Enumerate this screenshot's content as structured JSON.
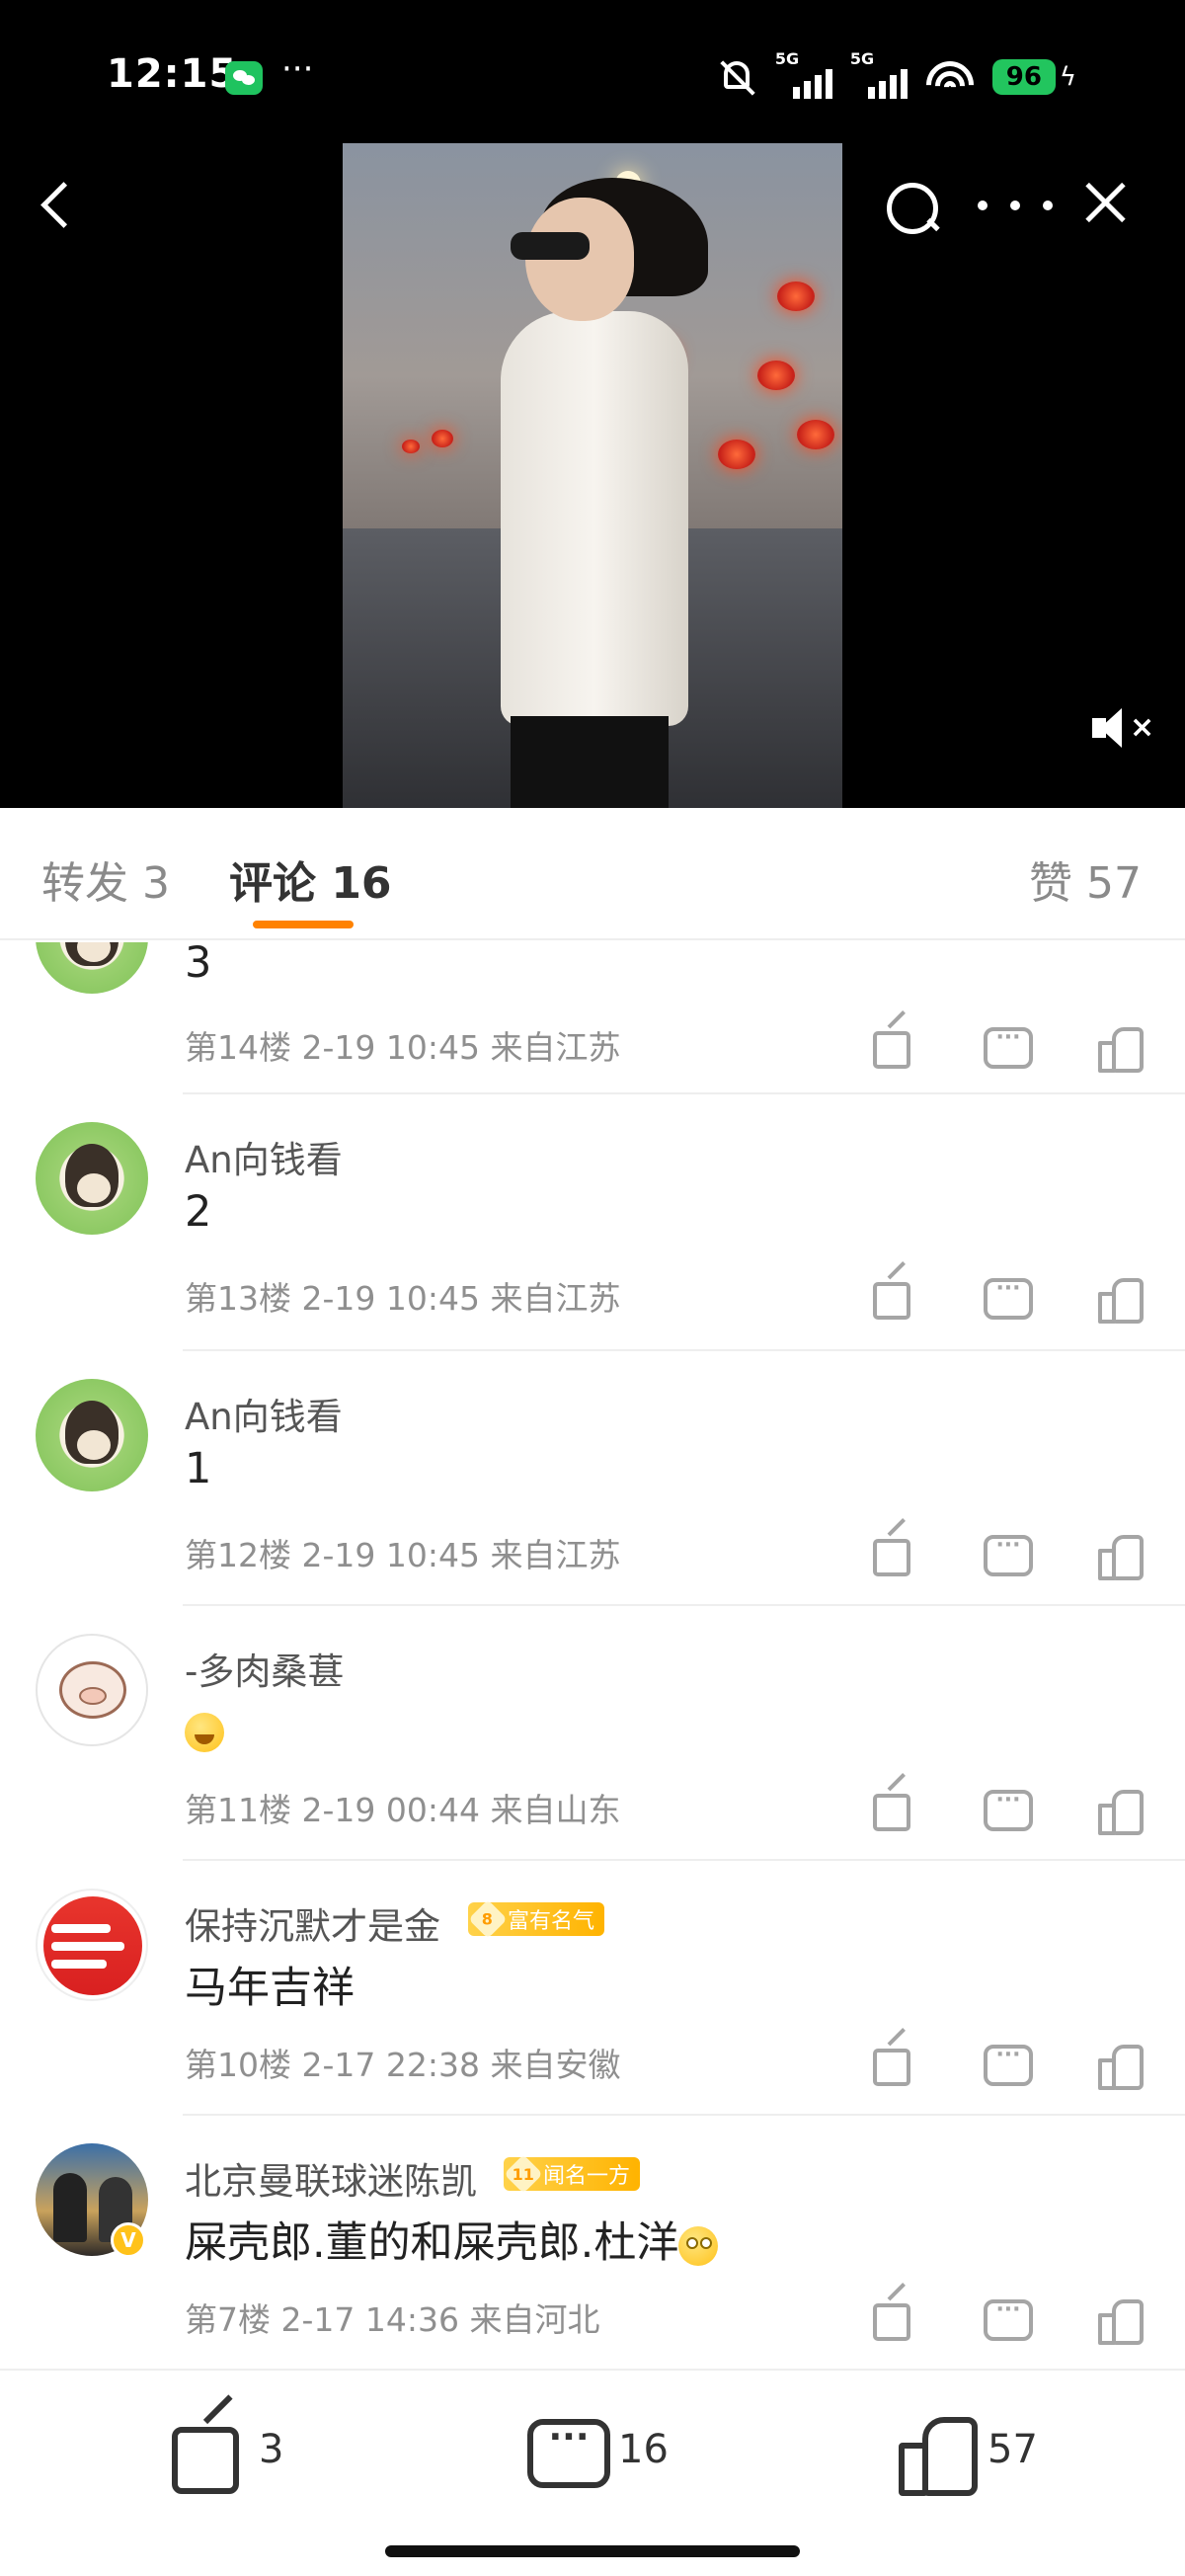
{
  "status_bar": {
    "time": "12:15",
    "dots": "···",
    "network1": "5G",
    "network2": "5G",
    "battery": "96"
  },
  "tabs": {
    "repost": "转发 3",
    "comments": "评论 16",
    "likes": "赞 57"
  },
  "comments": [
    {
      "username": "",
      "text": "3",
      "meta": "第14楼  2-19 10:45  来自江苏",
      "avatar": "anime"
    },
    {
      "username": "An向钱看",
      "text": "2",
      "meta": "第13楼  2-19 10:45  来自江苏",
      "avatar": "anime"
    },
    {
      "username": "An向钱看",
      "text": "1",
      "meta": "第12楼  2-19 10:45  来自江苏",
      "avatar": "anime"
    },
    {
      "username": "-多肉桑葚",
      "text": "",
      "emoji": "sob",
      "meta": "第11楼  2-19 00:44  来自山东",
      "avatar": "pig"
    },
    {
      "username": "保持沉默才是金",
      "badge_level": "8",
      "badge_text": "富有名气",
      "text": "马年吉祥",
      "meta": "第10楼  2-17 22:38  来自安徽",
      "avatar": "logo"
    },
    {
      "username": "北京曼联球迷陈凯",
      "badge_level": "11",
      "badge_text": "闻名一方",
      "text": "屎壳郎.董的和屎壳郎.杜洋",
      "emoji": "rolling-eyes",
      "meta": "第7楼  2-17 14:36  来自河北",
      "avatar": "photo",
      "verified": "V"
    }
  ],
  "bottom_bar": {
    "share_count": "3",
    "comment_count": "16",
    "like_count": "57"
  },
  "colors": {
    "accent": "#ff8200",
    "badge": "#ffb300",
    "battery": "#22c55e"
  }
}
